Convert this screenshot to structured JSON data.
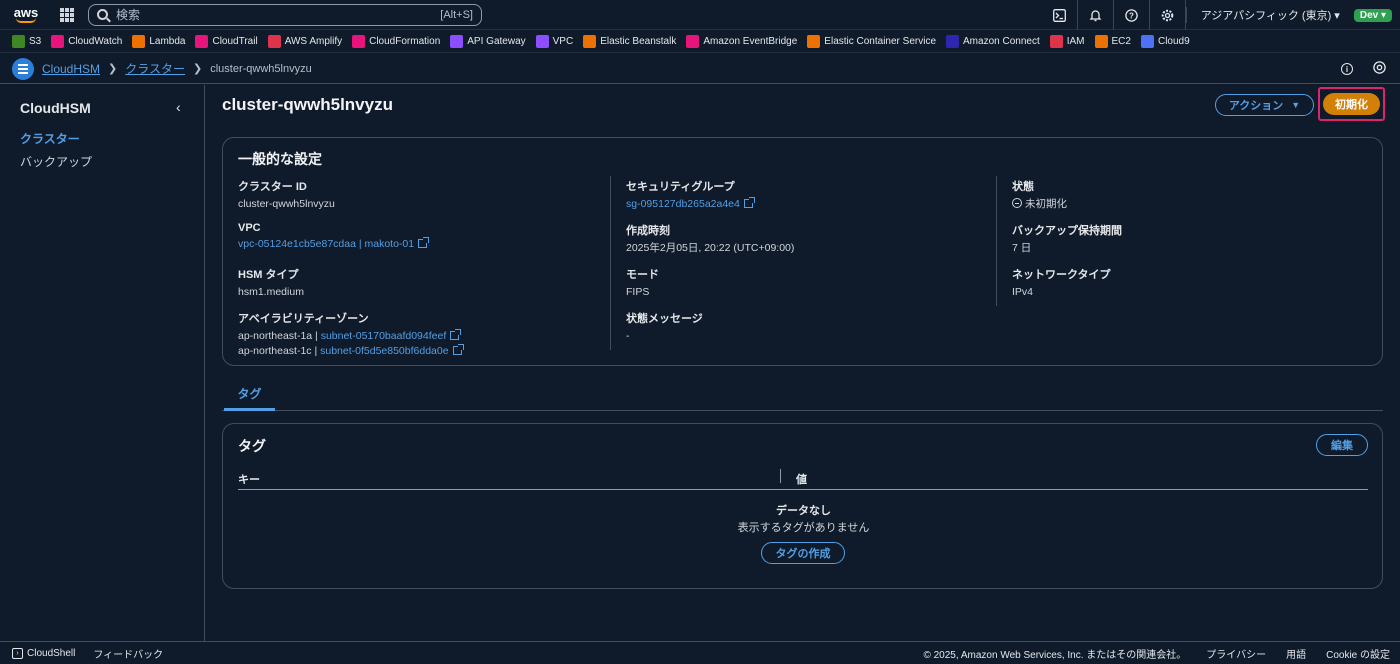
{
  "topnav": {
    "logo": "aws",
    "search_placeholder": "検索",
    "search_shortcut": "[Alt+S]",
    "region": "アジアパシフィック (東京) ▾",
    "account_badge": "Dev ▾",
    "icons": [
      "cloudshell-icon",
      "bell-icon",
      "help-icon",
      "gear-icon"
    ]
  },
  "favorites": [
    {
      "label": "S3",
      "color": "#3f8624"
    },
    {
      "label": "CloudWatch",
      "color": "#e7157b"
    },
    {
      "label": "Lambda",
      "color": "#ed7100"
    },
    {
      "label": "CloudTrail",
      "color": "#e7157b"
    },
    {
      "label": "AWS Amplify",
      "color": "#dd344c"
    },
    {
      "label": "CloudFormation",
      "color": "#e7157b"
    },
    {
      "label": "API Gateway",
      "color": "#8c4fff"
    },
    {
      "label": "VPC",
      "color": "#8c4fff"
    },
    {
      "label": "Elastic Beanstalk",
      "color": "#ed7100"
    },
    {
      "label": "Amazon EventBridge",
      "color": "#e7157b"
    },
    {
      "label": "Elastic Container Service",
      "color": "#ed7100"
    },
    {
      "label": "Amazon Connect",
      "color": "#2e27ad"
    },
    {
      "label": "IAM",
      "color": "#dd344c"
    },
    {
      "label": "EC2",
      "color": "#ed7100"
    },
    {
      "label": "Cloud9",
      "color": "#4d72f3"
    }
  ],
  "breadcrumb": {
    "items": [
      "CloudHSM",
      "クラスター"
    ],
    "current": "cluster-qwwh5lnvyzu"
  },
  "sidebar": {
    "title": "CloudHSM",
    "items": [
      {
        "label": "クラスター",
        "active": true
      },
      {
        "label": "バックアップ",
        "active": false
      }
    ]
  },
  "page": {
    "title": "cluster-qwwh5lnvyzu",
    "action_button": "アクション",
    "init_button": "初期化"
  },
  "general": {
    "title": "一般的な設定",
    "cluster_id_label": "クラスター ID",
    "cluster_id": "cluster-qwwh5lnvyzu",
    "vpc_label": "VPC",
    "vpc": "vpc-05124e1cb5e87cdaa | makoto-01",
    "hsm_type_label": "HSM タイプ",
    "hsm_type": "hsm1.medium",
    "az_label": "アベイラビリティーゾーン",
    "az1_prefix": "ap-northeast-1a | ",
    "az1_subnet": "subnet-05170baafd094feef",
    "az2_prefix": "ap-northeast-1c | ",
    "az2_subnet": "subnet-0f5d5e850bf6dda0e",
    "sg_label": "セキュリティグループ",
    "sg": "sg-095127db265a2a4e4",
    "created_label": "作成時刻",
    "created": "2025年2月05日, 20:22 (UTC+09:00)",
    "mode_label": "モード",
    "mode": "FIPS",
    "status_msg_label": "状態メッセージ",
    "status_msg": "-",
    "status_label": "状態",
    "status": "未初期化",
    "backup_label": "バックアップ保持期間",
    "backup": "7 日",
    "network_label": "ネットワークタイプ",
    "network": "IPv4"
  },
  "tabs": {
    "tag_tab": "タグ"
  },
  "tags": {
    "title": "タグ",
    "edit_button": "編集",
    "col_key": "キー",
    "col_value": "値",
    "empty_title": "データなし",
    "empty_desc": "表示するタグがありません",
    "create_button": "タグの作成"
  },
  "footer": {
    "cloudshell": "CloudShell",
    "feedback": "フィードバック",
    "copyright": "© 2025, Amazon Web Services, Inc. またはその関連会社。",
    "privacy": "プライバシー",
    "terms": "用語",
    "cookie": "Cookie の設定"
  }
}
